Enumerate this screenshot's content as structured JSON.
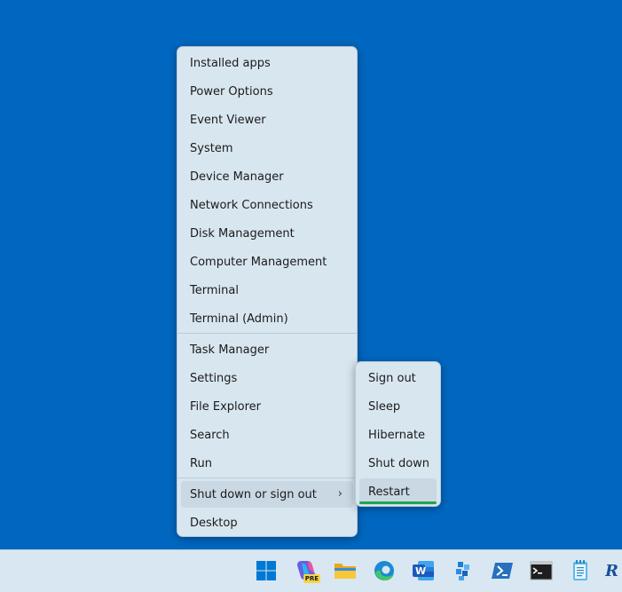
{
  "menu": {
    "items": [
      {
        "label": "Installed apps"
      },
      {
        "label": "Power Options"
      },
      {
        "label": "Event Viewer"
      },
      {
        "label": "System"
      },
      {
        "label": "Device Manager"
      },
      {
        "label": "Network Connections"
      },
      {
        "label": "Disk Management"
      },
      {
        "label": "Computer Management"
      },
      {
        "label": "Terminal"
      },
      {
        "label": "Terminal (Admin)"
      },
      {
        "label": "Task Manager"
      },
      {
        "label": "Settings"
      },
      {
        "label": "File Explorer"
      },
      {
        "label": "Search"
      },
      {
        "label": "Run"
      },
      {
        "label": "Shut down or sign out"
      },
      {
        "label": "Desktop"
      }
    ],
    "shutdown_arrow": "›"
  },
  "submenu": {
    "items": [
      {
        "label": "Sign out"
      },
      {
        "label": "Sleep"
      },
      {
        "label": "Hibernate"
      },
      {
        "label": "Shut down"
      },
      {
        "label": "Restart"
      }
    ]
  },
  "taskbar": {
    "icons": [
      {
        "name": "start-icon"
      },
      {
        "name": "copilot-preview-icon",
        "badge": "PRE"
      },
      {
        "name": "file-explorer-icon"
      },
      {
        "name": "edge-icon"
      },
      {
        "name": "word-icon",
        "letter": "W"
      },
      {
        "name": "hyper-v-icon"
      },
      {
        "name": "powershell-icon"
      },
      {
        "name": "command-prompt-icon"
      },
      {
        "name": "notepad-icon"
      },
      {
        "name": "partial-app-icon",
        "letter": "R"
      }
    ]
  }
}
